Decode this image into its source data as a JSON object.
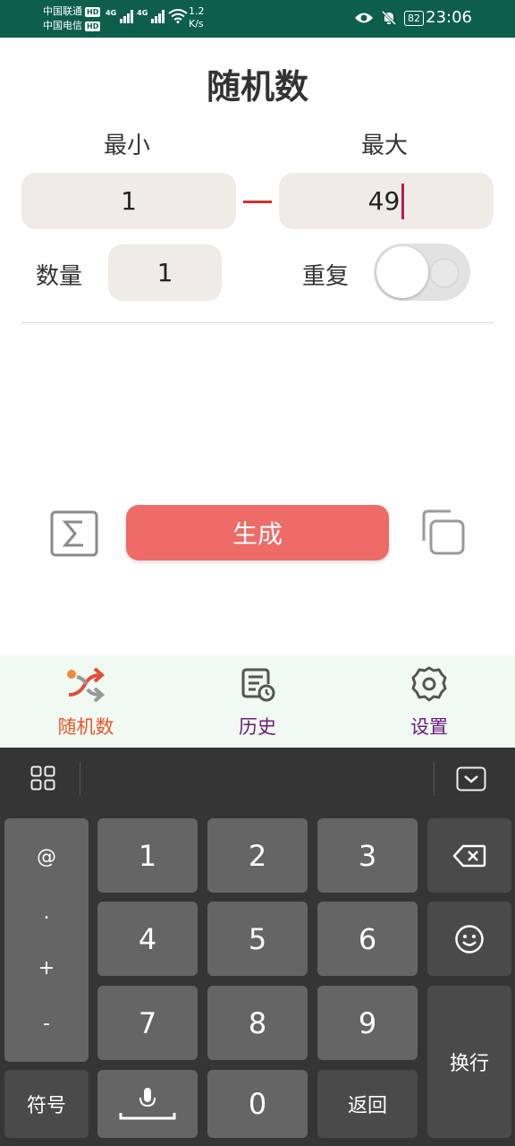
{
  "status_bar": {
    "carrier1": "中国联通",
    "carrier2": "中国电信",
    "hd_badge": "HD",
    "signal_type_1": "4G",
    "signal_type_2": "4G",
    "speed_value": "1.2",
    "speed_unit": "K/s",
    "battery": "82",
    "time": "23:06"
  },
  "page": {
    "title": "随机数",
    "min_label": "最小",
    "max_label": "最大",
    "min_value": "1",
    "max_value": "49",
    "count_label": "数量",
    "count_value": "1",
    "repeat_label": "重复",
    "repeat_enabled": false,
    "generate_label": "生成"
  },
  "bottom_nav": {
    "items": [
      {
        "label": "随机数",
        "icon": "shuffle-icon",
        "active": true,
        "color": "#e8572a"
      },
      {
        "label": "历史",
        "icon": "history-icon",
        "active": false,
        "color": "#6a1b7a"
      },
      {
        "label": "设置",
        "icon": "settings-icon",
        "active": false,
        "color": "#6a1b7a"
      }
    ]
  },
  "keyboard": {
    "sym_keys": [
      "@",
      ".",
      "+",
      "-"
    ],
    "digits": [
      "1",
      "2",
      "3",
      "4",
      "5",
      "6",
      "7",
      "8",
      "9",
      "0"
    ],
    "symbol_label": "符号",
    "back_label": "返回",
    "enter_label": "换行"
  },
  "colors": {
    "status_bar": "#0e5e4c",
    "accent_button": "#ee6b68",
    "field_bg": "#efebe6",
    "nav_bg": "#f1f9f3",
    "keyboard_bg": "#353535"
  }
}
